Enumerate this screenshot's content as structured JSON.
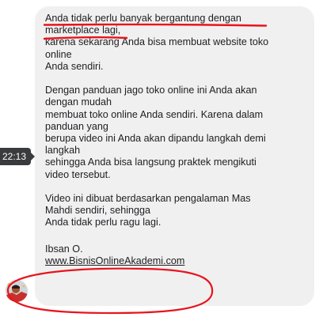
{
  "timestamp": "22:13",
  "message": {
    "lines": [
      "Anda tidak perlu banyak bergantung dengan",
      "marketplace lagi,",
      "karena sekarang Anda bisa membuat website toko",
      "online",
      "Anda sendiri.",
      "",
      "Dengan panduan jago toko online ini Anda akan",
      "dengan mudah",
      "membuat toko online Anda sendiri. Karena dalam",
      "panduan yang",
      "berupa video ini Anda akan dipandu langkah demi",
      "langkah",
      "sehingga Anda bisa langsung praktek mengikuti",
      "video tersebut.",
      "",
      "Video ini dibuat berdasarkan pengalaman Mas",
      "Mahdi sendiri, sehingga",
      "Anda tidak perlu ragu lagi."
    ],
    "signature_name": "Ibsan O.",
    "signature_link": "www.BisnisOnlineAkademi.com"
  },
  "colors": {
    "bubble_bg": "#f1f0f0",
    "text": "#1c1e21",
    "annotation_red": "#e8141c",
    "timestamp_bg": "#3a3b3c"
  },
  "icons": {
    "avatar": "sender-avatar"
  }
}
